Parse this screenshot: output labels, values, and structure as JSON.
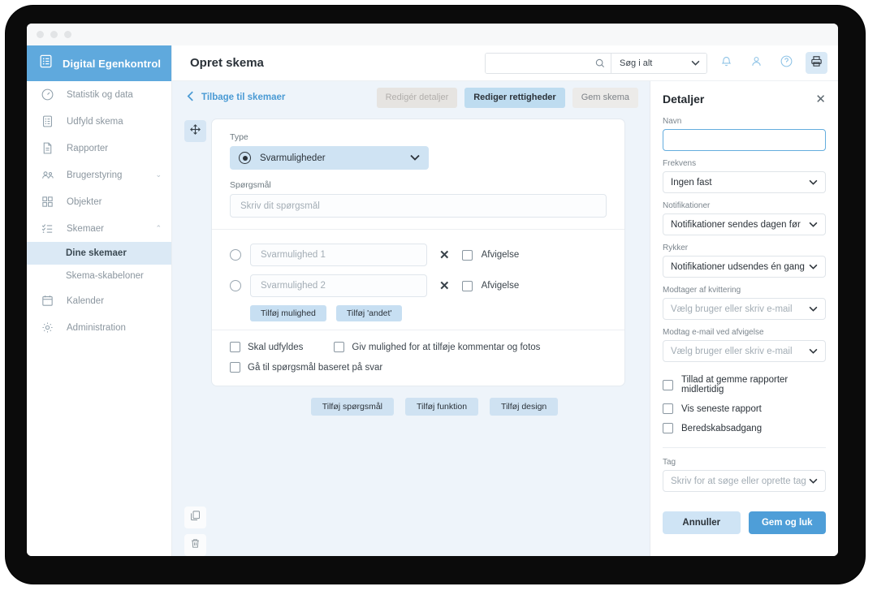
{
  "window": {
    "dots": 3
  },
  "brand": {
    "name": "Digital Egenkontrol",
    "icon": "clipboard-list-icon",
    "bg": "#5fa9dd"
  },
  "sidebar": {
    "items": [
      {
        "label": "Statistik og data",
        "icon": "gauge-icon",
        "caret": ""
      },
      {
        "label": "Udfyld skema",
        "icon": "clipboard-list-icon",
        "caret": ""
      },
      {
        "label": "Rapporter",
        "icon": "document-icon",
        "caret": ""
      },
      {
        "label": "Brugerstyring",
        "icon": "users-icon",
        "caret": "⌄"
      },
      {
        "label": "Objekter",
        "icon": "grid-qr-icon",
        "caret": ""
      },
      {
        "label": "Skemaer",
        "icon": "checklist-icon",
        "caret": "⌃"
      }
    ],
    "sub_items": [
      {
        "label": "Dine skemaer",
        "active": true
      },
      {
        "label": "Skema-skabeloner",
        "active": false
      }
    ],
    "items_after": [
      {
        "label": "Kalender",
        "icon": "calendar-icon",
        "caret": ""
      },
      {
        "label": "Administration",
        "icon": "gear-icon",
        "caret": ""
      }
    ]
  },
  "topbar": {
    "title": "Opret skema",
    "search": {
      "value": "",
      "placeholder": "",
      "icon": "search-icon"
    },
    "scope": {
      "value": "Søg i alt",
      "chevron": "⌄"
    },
    "icons": [
      {
        "name": "bell-icon",
        "highlighted": false
      },
      {
        "name": "user-icon",
        "highlighted": false
      },
      {
        "name": "help-circle-icon",
        "highlighted": false
      },
      {
        "name": "printer-icon",
        "highlighted": true
      }
    ]
  },
  "actionbar": {
    "back_label": "Tilbage til skemaer",
    "back_icon": "chevron-left-icon",
    "buttons": [
      {
        "label": "Redigér detaljer",
        "style": "muted"
      },
      {
        "label": "Rediger rettigheder",
        "style": "primary"
      },
      {
        "label": "Gem skema",
        "style": "plain"
      }
    ]
  },
  "gutter": {
    "drag": {
      "icon": "move-arrows-icon"
    },
    "copy": {
      "icon": "copy-icon"
    },
    "delete": {
      "icon": "trash-icon"
    }
  },
  "question_card": {
    "type_label": "Type",
    "type_value": "Svarmuligheder",
    "type_chevron": "⌄",
    "question_label": "Spørgsmål",
    "question_value": "",
    "question_placeholder": "Skriv dit spørgsmål",
    "options": [
      {
        "placeholder": "Svarmulighed 1",
        "value": "",
        "remove_icon": "close-icon",
        "deviation_label": "Afvigelse",
        "deviation_checked": false
      },
      {
        "placeholder": "Svarmulighed 2",
        "value": "",
        "remove_icon": "close-icon",
        "deviation_label": "Afvigelse",
        "deviation_checked": false
      }
    ],
    "option_buttons": [
      {
        "label": "Tilføj mulighed"
      },
      {
        "label": "Tilføj 'andet'"
      }
    ],
    "settings": [
      {
        "label": "Skal udfyldes",
        "checked": false
      },
      {
        "label": "Giv mulighed for at tilføje kommentar og fotos",
        "checked": false
      },
      {
        "label": "Gå til spørgsmål baseret på svar",
        "checked": false
      }
    ]
  },
  "bottom_buttons": [
    {
      "label": "Tilføj spørgsmål"
    },
    {
      "label": "Tilføj funktion"
    },
    {
      "label": "Tilføj design"
    }
  ],
  "details": {
    "title": "Detaljer",
    "close_icon": "close-icon",
    "name": {
      "label": "Navn",
      "value": "",
      "placeholder": ""
    },
    "frequency": {
      "label": "Frekvens",
      "value": "Ingen fast"
    },
    "notifications": {
      "label": "Notifikationer",
      "value": "Notifikationer sendes dagen før"
    },
    "reminder": {
      "label": "Rykker",
      "value": "Notifikationer udsendes én gang"
    },
    "receipt_recipient": {
      "label": "Modtager af kvittering",
      "value": "",
      "placeholder": "Vælg bruger eller skriv e-mail"
    },
    "deviation_email": {
      "label": "Modtag e-mail ved afvigelse",
      "value": "",
      "placeholder": "Vælg bruger eller skriv e-mail"
    },
    "checkboxes": [
      {
        "label": "Tillad at gemme rapporter midlertidig",
        "checked": false
      },
      {
        "label": "Vis seneste rapport",
        "checked": false
      },
      {
        "label": "Beredskabsadgang",
        "checked": false
      }
    ],
    "tag": {
      "label": "Tag",
      "value": "",
      "placeholder": "Skriv for at søge eller oprette tag"
    },
    "cancel_label": "Annuller",
    "save_label": "Gem og luk"
  },
  "colors": {
    "brand_blue": "#5fa9dd",
    "accent_blue": "#4e9ed8",
    "canvas_bg": "#eef4fa",
    "pill_blue": "#cfe2f2",
    "active_nav": "#dbe9f5"
  }
}
